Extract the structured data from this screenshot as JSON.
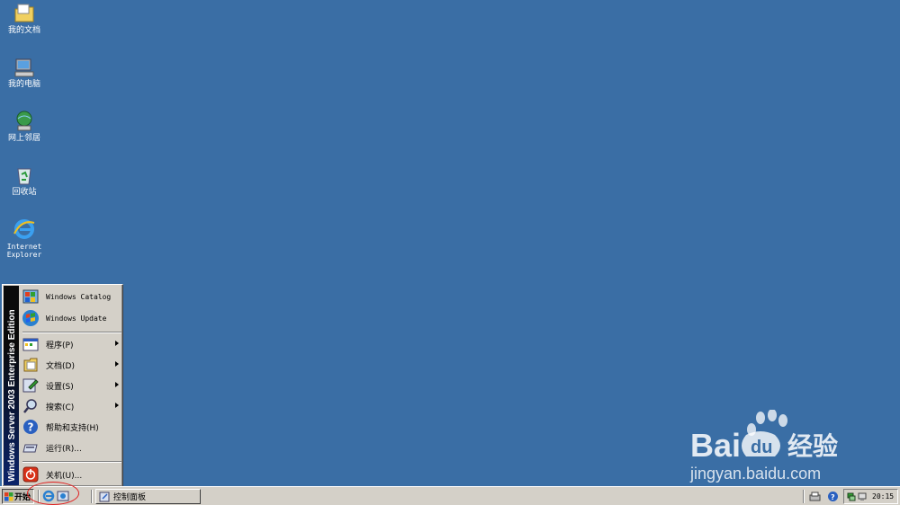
{
  "desktop": {
    "icons": [
      {
        "label": "我的文档"
      },
      {
        "label": "我的电脑"
      },
      {
        "label": "网上邻居"
      },
      {
        "label": "回收站"
      },
      {
        "label": "Internet\nExplorer"
      }
    ]
  },
  "start_menu": {
    "banner": "Windows Server 2003 Enterprise Edition",
    "pinned": [
      {
        "label": "Windows Catalog"
      },
      {
        "label": "Windows Update"
      }
    ],
    "items": [
      {
        "label": "程序(P)"
      },
      {
        "label": "文档(D)"
      },
      {
        "label": "设置(S)"
      },
      {
        "label": "搜索(C)"
      },
      {
        "label": "帮助和支持(H)"
      },
      {
        "label": "运行(R)..."
      }
    ],
    "shutdown": {
      "label": "关机(U)..."
    }
  },
  "taskbar": {
    "start_label": "开始",
    "task": {
      "label": "控制面板"
    },
    "clock": "20:15"
  },
  "watermark": {
    "brand": "Baidu经验",
    "url": "jingyan.baidu.com"
  },
  "colors": {
    "desktop": "#3a6ea5",
    "taskbar": "#d4d0c8",
    "annotation_circle": "#e02020"
  }
}
